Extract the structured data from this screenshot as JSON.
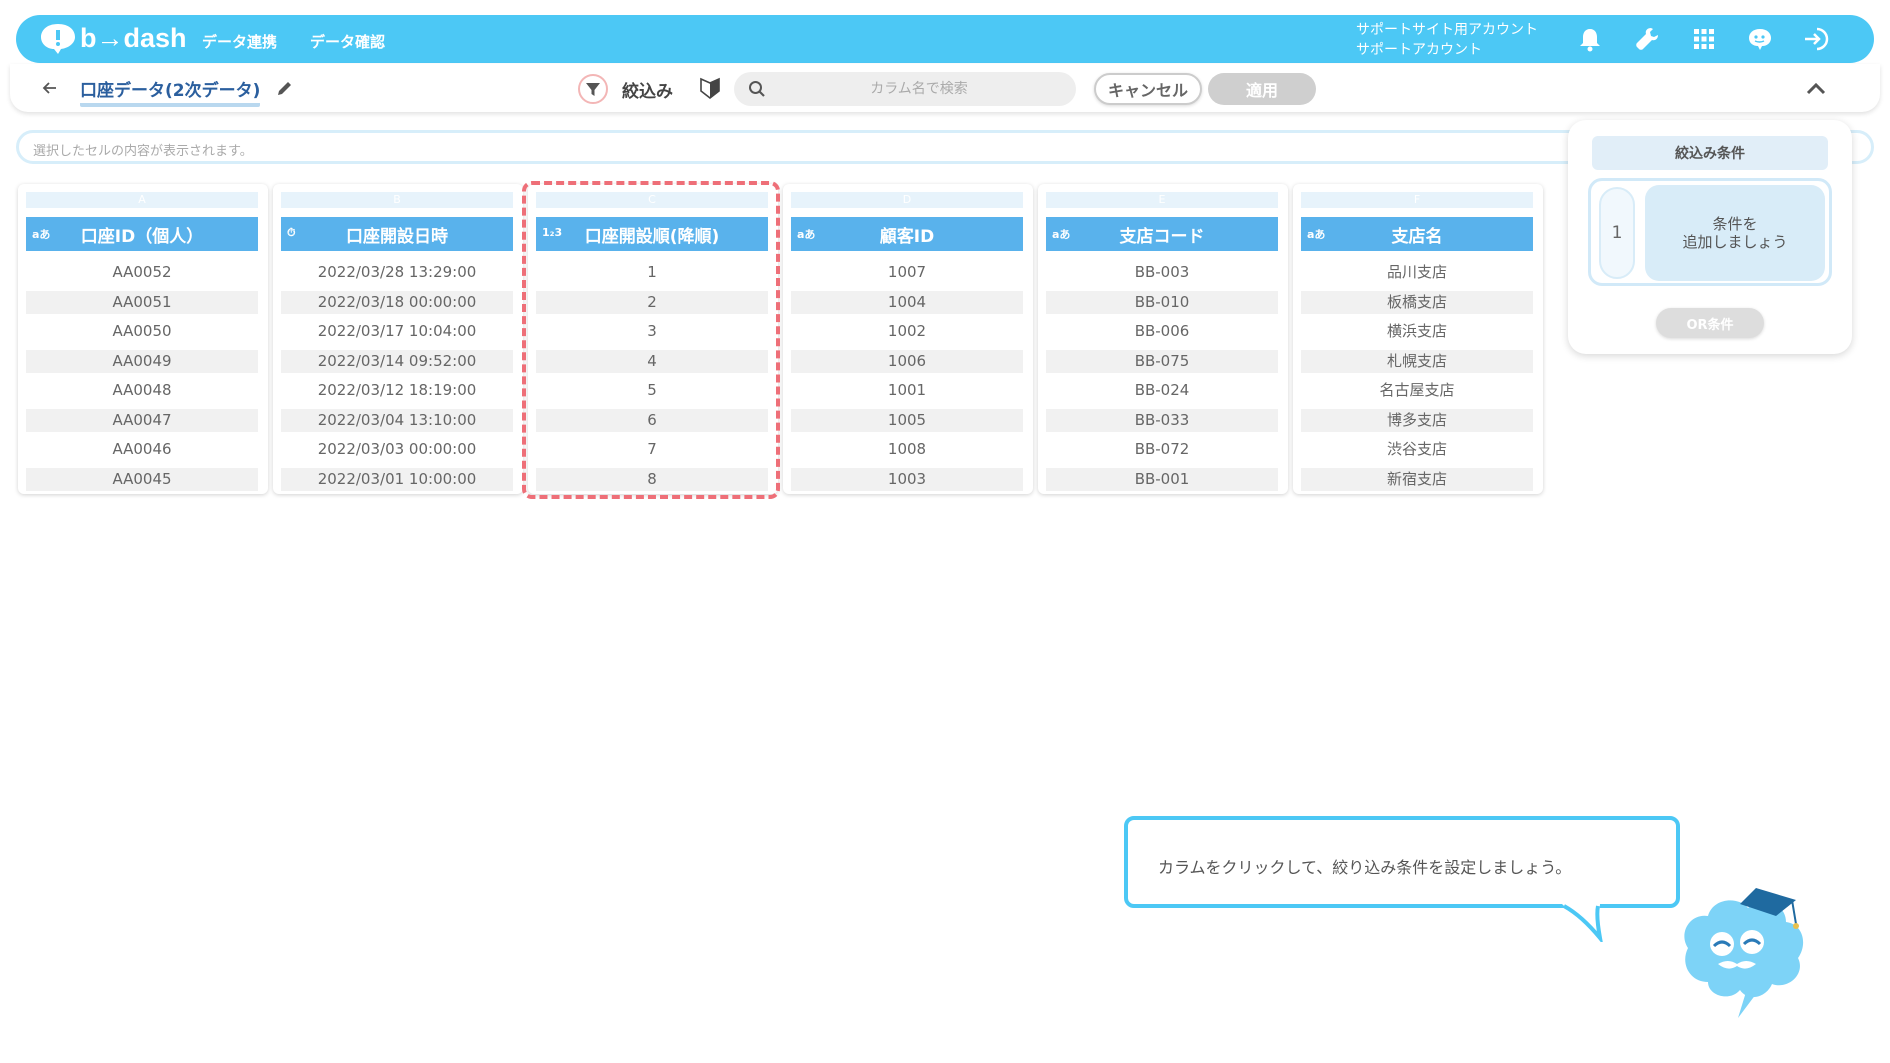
{
  "app": {
    "logo_text": "b→dash",
    "nav": [
      "データ連携",
      "データ確認"
    ],
    "account_line1": "サポートサイト用アカウント",
    "account_line2": "サポートアカウント"
  },
  "toolbar": {
    "dataset_title": "口座データ(2次データ)",
    "filter_label": "絞込み",
    "search_placeholder": "カラム名で検索",
    "cancel_label": "キャンセル",
    "apply_label": "適用"
  },
  "cellbar": {
    "placeholder": "選択したセルの内容が表示されます。"
  },
  "columns": [
    {
      "letter": "A",
      "type": "aあ",
      "header": "口座ID（個人）",
      "rows": [
        "AA0052",
        "AA0051",
        "AA0050",
        "AA0049",
        "AA0048",
        "AA0047",
        "AA0046",
        "AA0045"
      ]
    },
    {
      "letter": "B",
      "type": "⏱",
      "header": "口座開設日時",
      "rows": [
        "2022/03/28 13:29:00",
        "2022/03/18 00:00:00",
        "2022/03/17 10:04:00",
        "2022/03/14 09:52:00",
        "2022/03/12 18:19:00",
        "2022/03/04 13:10:00",
        "2022/03/03 00:00:00",
        "2022/03/01 10:00:00"
      ]
    },
    {
      "letter": "C",
      "type": "1₂3",
      "header": "口座開設順(降順)",
      "rows": [
        "1",
        "2",
        "3",
        "4",
        "5",
        "6",
        "7",
        "8"
      ]
    },
    {
      "letter": "D",
      "type": "aあ",
      "header": "顧客ID",
      "rows": [
        "1007",
        "1004",
        "1002",
        "1006",
        "1001",
        "1005",
        "1008",
        "1003"
      ]
    },
    {
      "letter": "E",
      "type": "aあ",
      "header": "支店コード",
      "rows": [
        "BB-003",
        "BB-010",
        "BB-006",
        "BB-075",
        "BB-024",
        "BB-033",
        "BB-072",
        "BB-001"
      ]
    },
    {
      "letter": "F",
      "type": "aあ",
      "header": "支店名",
      "rows": [
        "品川支店",
        "板橋支店",
        "横浜支店",
        "札幌支店",
        "名古屋支店",
        "博多支店",
        "渋谷支店",
        "新宿支店"
      ]
    }
  ],
  "conditions": {
    "title": "絞込み条件",
    "group_number": "1",
    "add_line1": "条件を",
    "add_line2": "追加しましょう",
    "or_label": "OR条件"
  },
  "guide": {
    "message": "カラムをクリックして、絞り込み条件を設定しましょう。"
  },
  "colors": {
    "brand": "#4cc8f5",
    "header": "#59b2ec",
    "highlight": "#ee6f78"
  }
}
